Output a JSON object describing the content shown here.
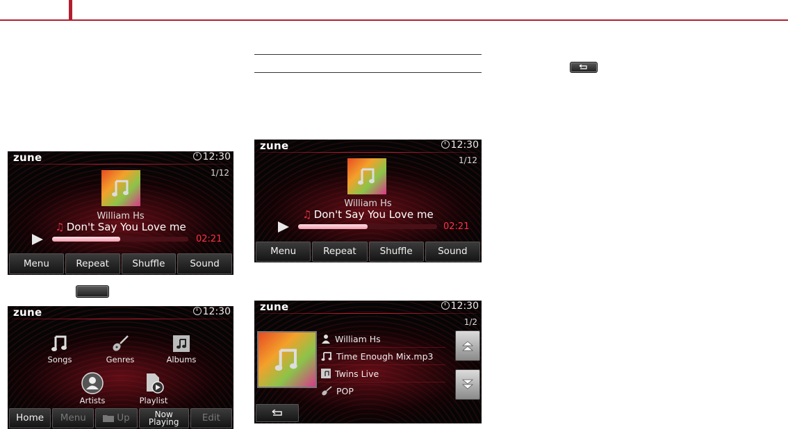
{
  "colors": {
    "accent": "#b31e2e",
    "time_red": "#ff3344"
  },
  "screens": {
    "now_playing_a": {
      "logo": "zune",
      "clock": "12:30",
      "track": "1/12",
      "artist": "William Hs",
      "song": "Don't Say You Love me",
      "time": "02:21",
      "progress": 0.5,
      "softkeys": [
        "Menu",
        "Repeat",
        "Shuffle",
        "Sound"
      ]
    },
    "now_playing_b": {
      "logo": "zune",
      "clock": "12:30",
      "track": "1/12",
      "artist": "William Hs",
      "song": "Don't Say You Love me",
      "time": "02:21",
      "progress": 0.5,
      "softkeys": [
        "Menu",
        "Repeat",
        "Shuffle",
        "Sound"
      ]
    },
    "menu": {
      "logo": "zune",
      "clock": "12:30",
      "items": [
        "Songs",
        "Genres",
        "Albums",
        "Artists",
        "Playlist"
      ],
      "softkeys": [
        "Home",
        "Menu",
        "Up",
        "Now Playing",
        "Edit"
      ]
    },
    "info": {
      "logo": "zune",
      "clock": "12:30",
      "page": "1/2",
      "rows": [
        "William Hs",
        "Time Enough Mix.mp3",
        "Twins Live",
        "POP"
      ]
    }
  },
  "icons": {
    "back": "back-arrow-icon",
    "note": "music-note-icon",
    "guitar": "guitar-icon",
    "album": "album-icon",
    "artist": "person-icon",
    "playlist": "playlist-icon",
    "folder": "folder-icon",
    "scroll_up": "double-chevron-up-icon",
    "scroll_down": "double-chevron-down-icon"
  }
}
